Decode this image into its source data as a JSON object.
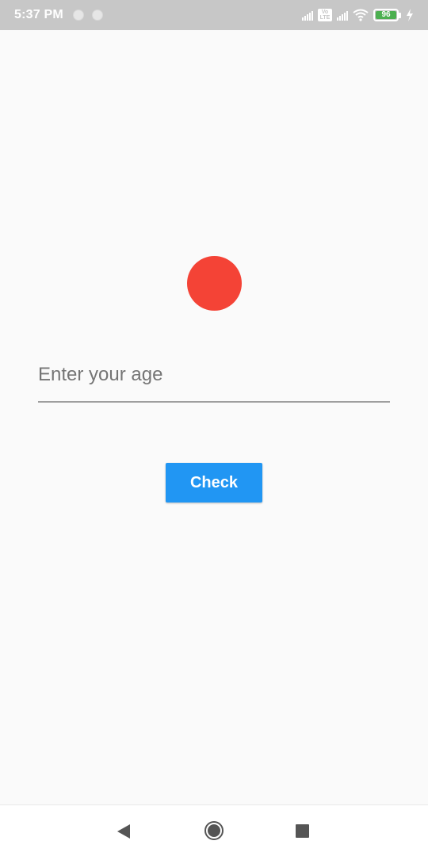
{
  "status_bar": {
    "time": "5:37 PM",
    "volte_label": "Vo LTE",
    "battery_level": "96",
    "icons": [
      "notification-dot-icon",
      "notification-dot-icon",
      "signal-icon",
      "volte-icon",
      "signal-icon",
      "wifi-icon",
      "battery-icon",
      "charging-icon"
    ]
  },
  "main": {
    "indicator_color": "#f44336",
    "age_input": {
      "placeholder": "Enter your age",
      "value": ""
    },
    "check_button_label": "Check",
    "accent_color": "#2196f3"
  },
  "nav_bar": {
    "icons": [
      "back-icon",
      "home-icon",
      "recents-icon"
    ]
  }
}
